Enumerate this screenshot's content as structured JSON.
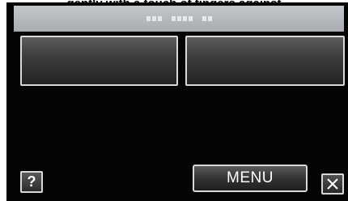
{
  "caption": {
    "text": "gently with a touch of fingers against"
  },
  "title_bar": {
    "text": ""
  },
  "buttons": {
    "option_left_label": "",
    "option_right_label": "",
    "help_label": "?",
    "menu_label": "MENU"
  },
  "icons": {
    "help": "question-mark-icon",
    "close": "close-x-icon"
  },
  "colors": {
    "screen_background": "#050505",
    "title_bar": "#b4b8bc",
    "button_border": "#d8d8d8",
    "button_text": "#ffffff"
  }
}
